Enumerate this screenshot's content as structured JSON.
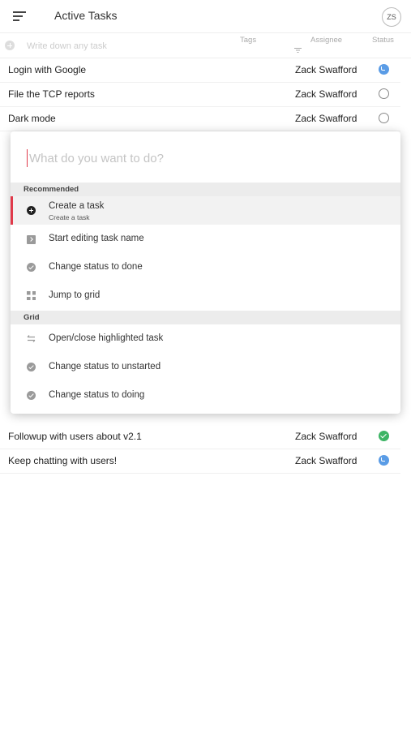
{
  "header": {
    "title": "Active Tasks",
    "avatar_initials": "ZS"
  },
  "table": {
    "new_task_placeholder": "Write down any task",
    "columns": {
      "tags": "Tags",
      "assignee": "Assignee",
      "status": "Status"
    },
    "rows": [
      {
        "name": "Login with Google",
        "assignee": "Zack Swafford",
        "status": "doing"
      },
      {
        "name": "File the TCP reports",
        "assignee": "Zack Swafford",
        "status": "unstarted"
      },
      {
        "name": "Dark mode",
        "assignee": "Zack Swafford",
        "status": "unstarted"
      },
      {
        "name": "Followup with users about v2.1",
        "assignee": "Zack Swafford",
        "status": "done"
      },
      {
        "name": "Keep chatting with users!",
        "assignee": "Zack Swafford",
        "status": "doing"
      }
    ]
  },
  "palette": {
    "placeholder": "What do you want to do?",
    "sections": [
      {
        "title": "Recommended",
        "items": [
          {
            "label": "Create a task",
            "sublabel": "Create a task",
            "icon": "plus-circle-icon",
            "active": true
          },
          {
            "label": "Start editing task name",
            "icon": "edit-icon"
          },
          {
            "label": "Change status to done",
            "icon": "check-circle-icon"
          },
          {
            "label": "Jump to grid",
            "icon": "grid-icon"
          }
        ]
      },
      {
        "title": "Grid",
        "items": [
          {
            "label": "Open/close highlighted task",
            "icon": "swap-arrows-icon"
          },
          {
            "label": "Change status to unstarted",
            "icon": "check-circle-icon"
          },
          {
            "label": "Change status to doing",
            "icon": "check-circle-icon"
          }
        ]
      }
    ]
  },
  "colors": {
    "accent": "#e03a4a",
    "status_doing": "#5a9ce6",
    "status_done": "#3cb464",
    "status_unstarted": "#888888"
  }
}
